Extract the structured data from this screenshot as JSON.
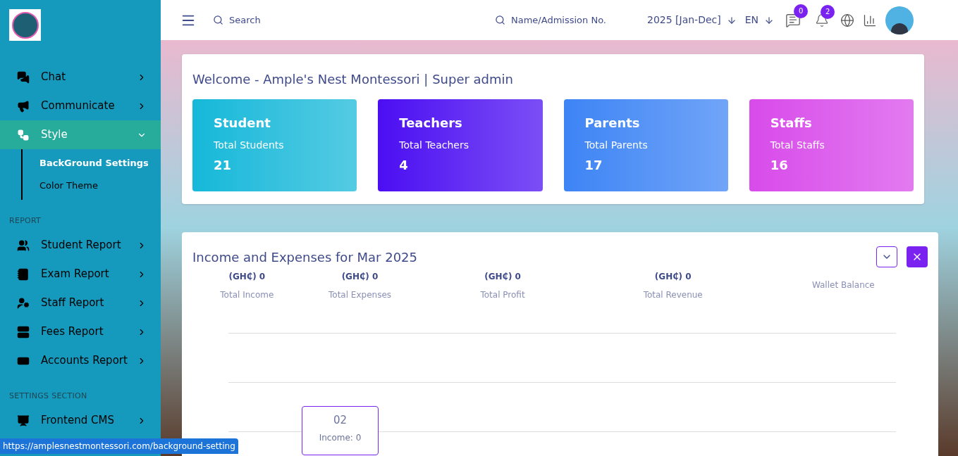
{
  "sidebar": {
    "sections": [
      {
        "items": [
          {
            "label": "Chat",
            "selected": false,
            "expanded": false
          },
          {
            "label": "Communicate",
            "selected": false,
            "expanded": false
          },
          {
            "label": "Style",
            "selected": true,
            "expanded": true,
            "children": [
              {
                "label": "BackGround Settings",
                "selected": true
              },
              {
                "label": "Color Theme",
                "selected": false
              }
            ]
          }
        ]
      },
      {
        "title": "REPORT",
        "items": [
          {
            "label": "Student Report",
            "selected": false,
            "expanded": false
          },
          {
            "label": "Exam Report",
            "selected": false,
            "expanded": false
          },
          {
            "label": "Staff Report",
            "selected": false,
            "expanded": false
          },
          {
            "label": "Fees Report",
            "selected": false,
            "expanded": false
          },
          {
            "label": "Accounts Report",
            "selected": false,
            "expanded": false
          }
        ]
      },
      {
        "title": "SETTINGS SECTION",
        "items": [
          {
            "label": "Frontend CMS",
            "selected": false,
            "expanded": false
          }
        ]
      }
    ]
  },
  "header": {
    "search": {
      "placeholder": "Search"
    },
    "admission_search": {
      "placeholder": "Name/Admission No."
    },
    "session": "2025 [Jan-Dec]",
    "language": "EN",
    "messages_badge": "0",
    "notifications_badge": "2"
  },
  "welcome": {
    "title": "Welcome - Ample's Nest Montessori | Super admin",
    "cards": [
      {
        "title": "Student",
        "label": "Total Students",
        "value": "21",
        "color": "#16b8d9"
      },
      {
        "title": "Teachers",
        "label": "Total Teachers",
        "value": "4",
        "color": "#4b0ef2"
      },
      {
        "title": "Parents",
        "label": "Total Parents",
        "value": "17",
        "color": "#3d84f5"
      },
      {
        "title": "Staffs",
        "label": "Total Staffs",
        "value": "16",
        "color": "#d84bea"
      }
    ]
  },
  "income": {
    "title": "Income and Expenses for Mar 2025",
    "stats": [
      {
        "value": "(GH₵) 0",
        "label": "Total Income"
      },
      {
        "value": "(GH₵) 0",
        "label": "Total Expenses"
      },
      {
        "value": "(GH₵) 0",
        "label": "Total Profit"
      },
      {
        "value": "(GH₵) 0",
        "label": "Total Revenue"
      },
      {
        "label": "Wallet Balance"
      }
    ],
    "tooltip": {
      "title": "02",
      "text": "Income: 0"
    }
  },
  "status_url": "https://amplesnestmontessori.com/background-setting"
}
